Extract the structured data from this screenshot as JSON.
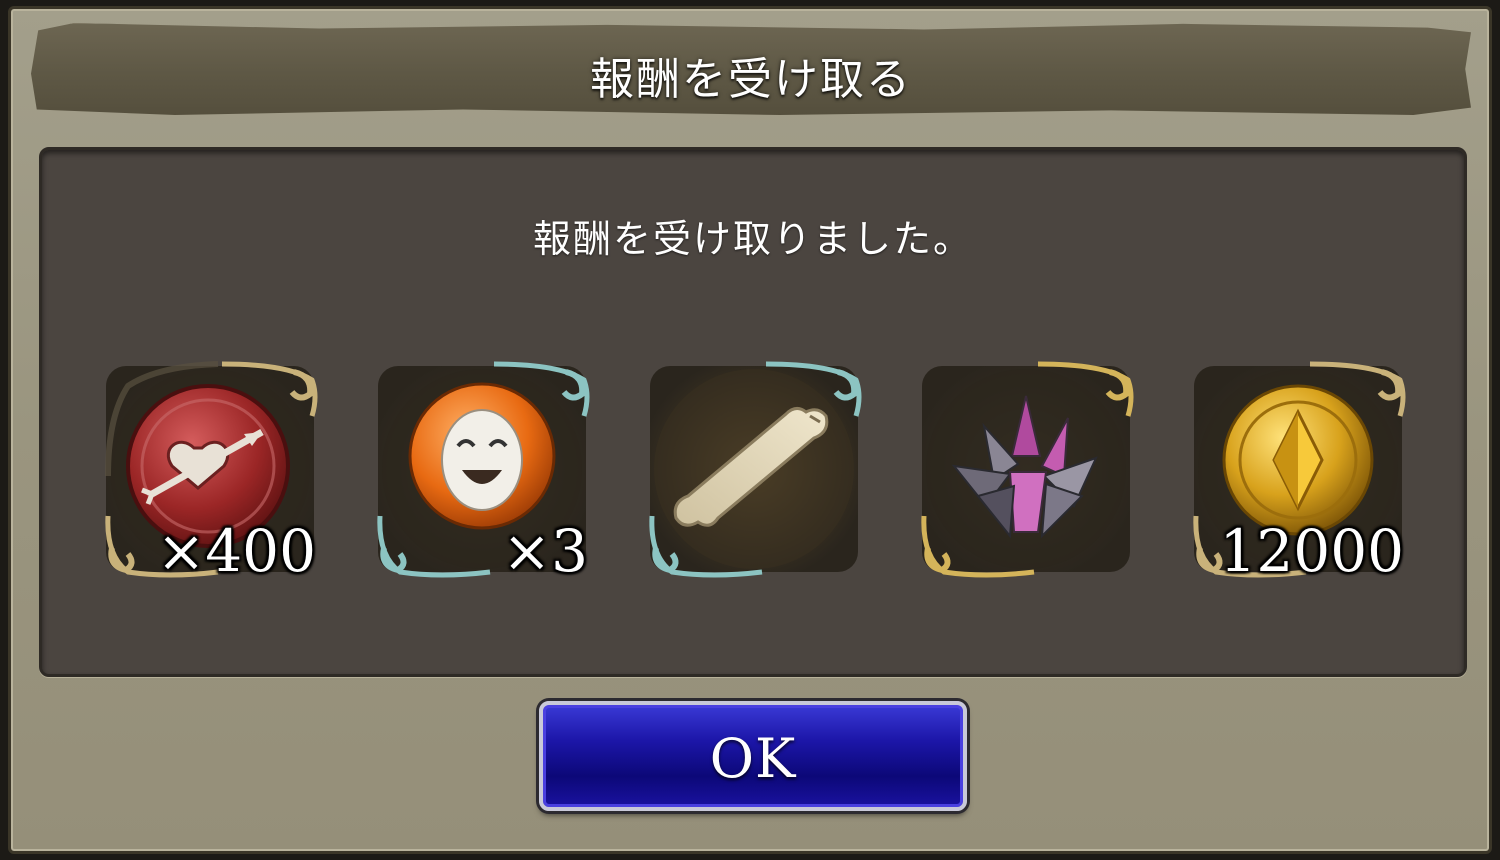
{
  "dialog": {
    "title": "報酬を受け取る",
    "message": "報酬を受け取りました。",
    "ok_label": "OK"
  },
  "rewards": [
    {
      "icon": "red-heart-arrow-medal-icon",
      "frame": "gold",
      "quantity": "×400"
    },
    {
      "icon": "smiling-mask-orb-icon",
      "frame": "teal",
      "quantity": "×3"
    },
    {
      "icon": "bone-icon",
      "frame": "teal",
      "quantity": ""
    },
    {
      "icon": "purple-crystal-cluster-icon",
      "frame": "gold",
      "quantity": ""
    },
    {
      "icon": "gold-coin-icon",
      "frame": "gold",
      "quantity": "12000"
    }
  ],
  "colors": {
    "frame_gold": "#b8a472",
    "frame_teal": "#7fb8b8",
    "button_blue": "#1c16a8",
    "panel": "#4b4540"
  }
}
